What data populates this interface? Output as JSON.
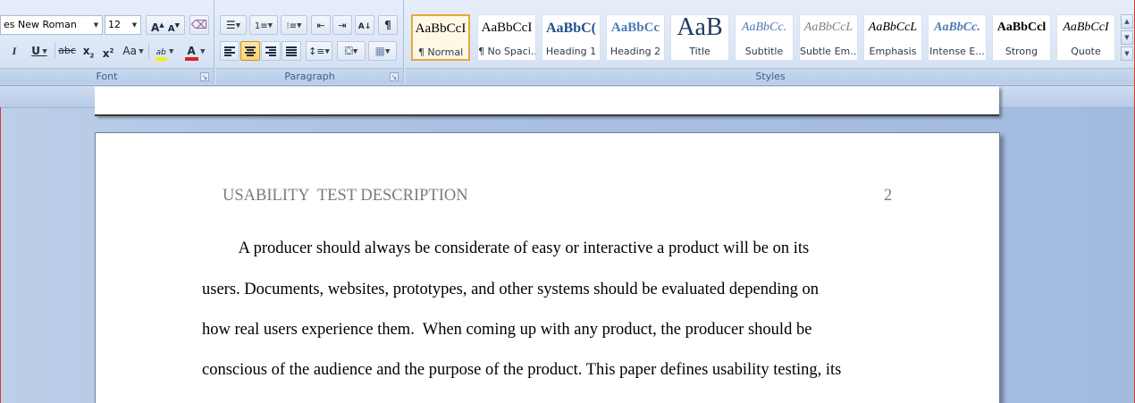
{
  "font_group": {
    "label": "Font",
    "font_name": "es New Roman",
    "font_size": "12",
    "grow_label": "A",
    "shrink_label": "A",
    "italic_label": "I",
    "underline_label": "U",
    "strike_label": "abc",
    "subscript_label": "x",
    "superscript_label": "x",
    "change_case_label": "Aa",
    "highlight_label": "ab",
    "font_color_label": "A"
  },
  "paragraph_group": {
    "label": "Paragraph",
    "show_marks_label": "¶"
  },
  "styles_group": {
    "label": "Styles",
    "items": [
      {
        "sample": "AaBbCcI",
        "name": "¶ Normal"
      },
      {
        "sample": "AaBbCcI",
        "name": "¶ No Spaci..."
      },
      {
        "sample": "AaBbC(",
        "name": "Heading 1"
      },
      {
        "sample": "AaBbCc",
        "name": "Heading 2"
      },
      {
        "sample": "AaB",
        "name": "Title"
      },
      {
        "sample": "AaBbCc.",
        "name": "Subtitle"
      },
      {
        "sample": "AaBbCcL",
        "name": "Subtle Em..."
      },
      {
        "sample": "AaBbCcL",
        "name": "Emphasis"
      },
      {
        "sample": "AaBbCc.",
        "name": "Intense E..."
      },
      {
        "sample": "AaBbCcl",
        "name": "Strong"
      },
      {
        "sample": "AaBbCcI",
        "name": "Quote"
      }
    ]
  },
  "document": {
    "header_title": "USABILITY  TEST DESCRIPTION",
    "page_number": "2",
    "lines": [
      "         A producer should always be considerate of easy or interactive a product will be on its",
      "users. Documents, websites, prototypes, and other systems should be evaluated depending on",
      "how real users experience them.  When coming up with any product, the producer should be",
      "conscious of the audience and the purpose of the product. This paper defines usability testing, its"
    ]
  },
  "colors": {
    "ribbon_bg": "#dbe6f6",
    "group_label": "#3e5f8a",
    "selected_style_border": "#e6a83c",
    "font_color_bar": "#e02020",
    "highlight_bar": "#f5f000",
    "header_text": "#7b7b7b"
  }
}
